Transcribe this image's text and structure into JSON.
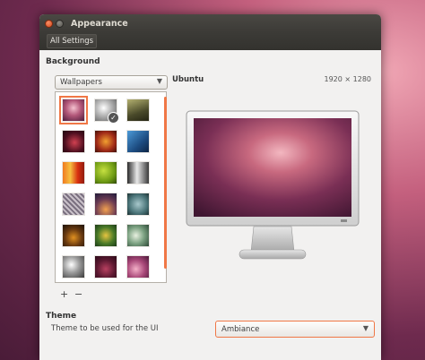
{
  "window": {
    "title": "Appearance"
  },
  "toolbar": {
    "all_settings": "All Settings"
  },
  "background": {
    "section_label": "Background",
    "source_selected": "Wallpapers",
    "add_label": "+",
    "remove_label": "−",
    "preview_name": "Ubuntu",
    "preview_resolution": "1920 × 1280",
    "wallpapers": [
      {
        "icon": "wallpaper-thumb"
      },
      {
        "icon": "wallpaper-thumb"
      },
      {
        "icon": "wallpaper-thumb"
      },
      {
        "icon": "wallpaper-thumb"
      },
      {
        "icon": "wallpaper-thumb"
      },
      {
        "icon": "wallpaper-thumb"
      },
      {
        "icon": "wallpaper-thumb"
      },
      {
        "icon": "wallpaper-thumb"
      },
      {
        "icon": "wallpaper-thumb"
      },
      {
        "icon": "wallpaper-thumb"
      },
      {
        "icon": "wallpaper-thumb"
      },
      {
        "icon": "wallpaper-thumb"
      },
      {
        "icon": "wallpaper-thumb"
      },
      {
        "icon": "wallpaper-thumb"
      },
      {
        "icon": "wallpaper-thumb"
      },
      {
        "icon": "wallpaper-thumb"
      },
      {
        "icon": "wallpaper-thumb"
      },
      {
        "icon": "wallpaper-thumb"
      }
    ]
  },
  "theme": {
    "section_label": "Theme",
    "description": "Theme to be used for the UI",
    "selected": "Ambiance"
  },
  "colors": {
    "accent": "#f07746",
    "titlebar": "#3c3b37"
  }
}
